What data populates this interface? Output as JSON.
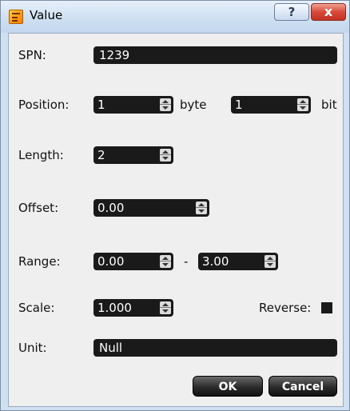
{
  "window": {
    "title": "Value",
    "help_label": "?",
    "close_label": "x"
  },
  "spn": {
    "label": "SPN:",
    "value": "1239"
  },
  "position": {
    "label": "Position:",
    "byte_value": "1",
    "byte_unit": "byte",
    "bit_value": "1",
    "bit_unit": "bit"
  },
  "length": {
    "label": "Length:",
    "value": "2"
  },
  "offset": {
    "label": "Offset:",
    "value": "0.00"
  },
  "range": {
    "label": "Range:",
    "min": "0.00",
    "separator": "-",
    "max": "3.00"
  },
  "scale": {
    "label": "Scale:",
    "value": "1.000"
  },
  "reverse": {
    "label": "Reverse:"
  },
  "unit": {
    "label": "Unit:",
    "value": "Null"
  },
  "buttons": {
    "ok": "OK",
    "cancel": "Cancel"
  }
}
